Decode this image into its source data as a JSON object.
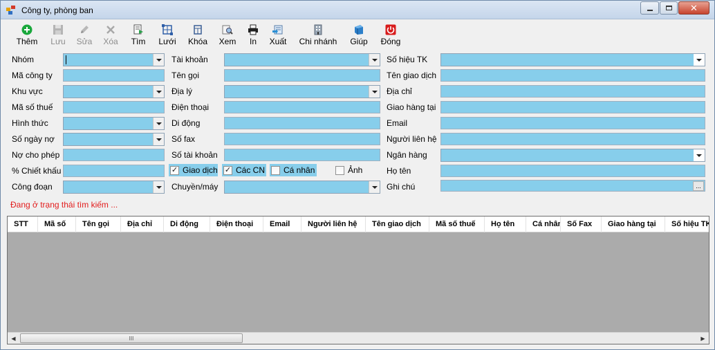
{
  "window": {
    "title": "Công ty, phòng ban"
  },
  "toolbar": {
    "buttons": [
      {
        "label": "Thêm",
        "icon": "add-icon",
        "enabled": true
      },
      {
        "label": "Lưu",
        "icon": "save-icon",
        "enabled": false
      },
      {
        "label": "Sửa",
        "icon": "pencil-icon",
        "enabled": false
      },
      {
        "label": "Xóa",
        "icon": "delete-icon",
        "enabled": false
      },
      {
        "label": "Tìm",
        "icon": "find-icon",
        "enabled": true
      },
      {
        "label": "Lưới",
        "icon": "grid-icon",
        "enabled": true
      },
      {
        "label": "Khóa",
        "icon": "lock-icon",
        "enabled": true
      },
      {
        "label": "Xem",
        "icon": "view-icon",
        "enabled": true
      },
      {
        "label": "In",
        "icon": "print-icon",
        "enabled": true
      },
      {
        "label": "Xuất",
        "icon": "export-icon",
        "enabled": true
      },
      {
        "label": "Chi nhánh",
        "icon": "branch-icon",
        "enabled": true
      },
      {
        "label": "Giúp",
        "icon": "help-icon",
        "enabled": true
      },
      {
        "label": "Đóng",
        "icon": "power-icon",
        "enabled": true
      }
    ]
  },
  "form": {
    "col1": [
      {
        "label": "Nhóm",
        "type": "combo",
        "value": ""
      },
      {
        "label": "Mã công ty",
        "type": "text",
        "value": ""
      },
      {
        "label": "Khu vực",
        "type": "combo",
        "value": ""
      },
      {
        "label": "Mã số thuế",
        "type": "text",
        "value": ""
      },
      {
        "label": "Hình thức",
        "type": "combo",
        "value": ""
      },
      {
        "label": "Số ngày  nợ",
        "type": "combo",
        "value": ""
      },
      {
        "label": "Nợ cho phép",
        "type": "text",
        "value": ""
      },
      {
        "label": "% Chiết khấu",
        "type": "text",
        "value": ""
      },
      {
        "label": "Công đoạn",
        "type": "combo",
        "value": ""
      }
    ],
    "col2": [
      {
        "label": "Tài khoản",
        "type": "combo",
        "value": ""
      },
      {
        "label": "Tên gọi",
        "type": "text",
        "value": ""
      },
      {
        "label": "Địa lý",
        "type": "combo",
        "value": ""
      },
      {
        "label": "Điện thoại",
        "type": "text",
        "value": ""
      },
      {
        "label": "Di động",
        "type": "text",
        "value": ""
      },
      {
        "label": "Số fax",
        "type": "text",
        "value": ""
      },
      {
        "label": "Số tài khoản",
        "type": "text",
        "value": ""
      },
      {
        "label": "",
        "type": "checks",
        "value": ""
      },
      {
        "label": "Chuyền/máy",
        "type": "combo",
        "value": ""
      }
    ],
    "col3": [
      {
        "label": "Số hiệu TK",
        "type": "combo",
        "value": ""
      },
      {
        "label": "Tên giao dịch",
        "type": "text",
        "value": ""
      },
      {
        "label": "Địa chỉ",
        "type": "text",
        "value": ""
      },
      {
        "label": "Giao hàng tại",
        "type": "text",
        "value": ""
      },
      {
        "label": "Email",
        "type": "text",
        "value": ""
      },
      {
        "label": "Người liên hệ",
        "type": "text",
        "value": ""
      },
      {
        "label": "Ngân hàng",
        "type": "combo",
        "value": ""
      },
      {
        "label": "Họ tên",
        "type": "text",
        "value": ""
      },
      {
        "label": "Ghi chú",
        "type": "memo",
        "value": ""
      }
    ],
    "checks": [
      {
        "label": "Giao dịch",
        "checked": true
      },
      {
        "label": "Các CN",
        "checked": true
      },
      {
        "label": "Cá nhân",
        "checked": false
      },
      {
        "label": "Ảnh",
        "checked": false
      }
    ],
    "ellipsis": "..."
  },
  "status": {
    "text": "Đang ở trạng thái tìm kiếm ..."
  },
  "grid": {
    "columns": [
      "STT",
      "Mã số",
      "Tên gọi",
      "Địa chỉ",
      "Di động",
      "Điện thoại",
      "Email",
      "Người liên hệ",
      "Tên giao dịch",
      "Mã số thuế",
      "Họ tên",
      "Cá nhân",
      "Số Fax",
      "Giao hàng tại",
      "Số hiệu TK"
    ],
    "scroll_thumb": "III"
  },
  "colors": {
    "field_bg": "#87ceeb",
    "status_text": "#e21c1c",
    "grid_bg": "#ababab"
  }
}
